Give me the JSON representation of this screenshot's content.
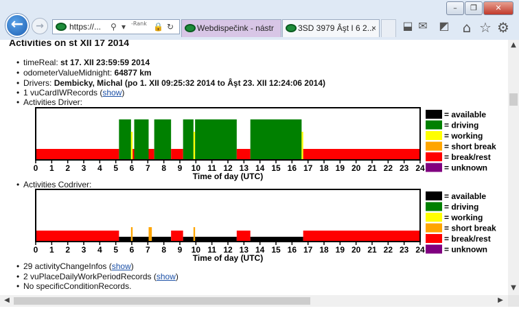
{
  "browser": {
    "window_controls": [
      "–",
      "❐",
      "✕"
    ],
    "back_glyph": "←",
    "forward_glyph": "→",
    "address_text": "https://...",
    "search_glyph": "⚲",
    "dropdown_glyph": "▾",
    "rank_text": "-Rank",
    "lock_glyph": "🔒",
    "refresh_glyph": "↻",
    "tabs": [
      {
        "label": "Webdispečink - nástr",
        "active": true
      },
      {
        "label": "3SD 3979 Âşt I 6 2...",
        "active": false
      }
    ],
    "tab_close": "×",
    "toolbar_icons": [
      "⬓",
      "✉",
      "◩",
      "⌂",
      "☆",
      "⚙"
    ]
  },
  "page": {
    "title": "Activities on st XII 17 2014",
    "items": [
      {
        "key": "timeReal:",
        "value": "st 17. XII 23:59:59 2014"
      },
      {
        "key": "odometerValueMidnight:",
        "value": "64877 km"
      },
      {
        "key": "Drivers:",
        "value": "Dembicky, Michal (po 1. XII 09:25:32 2014 to Âşt 23. XII 12:24:06 2014)"
      },
      {
        "key": "1 vuCardIWRecords (",
        "link": "show",
        "tail": ")"
      },
      {
        "key": "Activities Driver:"
      }
    ],
    "codriver_label": "Activities Codriver:",
    "bottom_items": [
      {
        "key": "29 activityChangeInfos (",
        "link": "show",
        "tail": ")"
      },
      {
        "key": "2 vuPlaceDailyWorkPeriodRecords (",
        "link": "show",
        "tail": ")"
      },
      {
        "key": "No specificConditionRecords."
      }
    ]
  },
  "chart_data": [
    {
      "type": "timeline",
      "title": "",
      "xlabel": "Time of day (UTC)",
      "xlim": [
        0,
        24
      ],
      "x_ticks": [
        0,
        1,
        2,
        3,
        4,
        5,
        6,
        7,
        8,
        9,
        10,
        11,
        12,
        13,
        14,
        15,
        16,
        17,
        18,
        19,
        20,
        21,
        22,
        23,
        24
      ],
      "legend": [
        {
          "label": "= available",
          "color": "#000000"
        },
        {
          "label": "= driving",
          "color": "#008000"
        },
        {
          "label": "= working",
          "color": "#ffff00"
        },
        {
          "label": "= short break",
          "color": "#ffa500"
        },
        {
          "label": "= break/rest",
          "color": "#ff0000"
        },
        {
          "label": "= unknown",
          "color": "#800080"
        }
      ],
      "segments": [
        {
          "start": 0.0,
          "end": 5.2,
          "activity": "break/rest"
        },
        {
          "start": 5.2,
          "end": 5.95,
          "activity": "driving"
        },
        {
          "start": 5.95,
          "end": 6.05,
          "activity": "working"
        },
        {
          "start": 6.05,
          "end": 6.15,
          "activity": "break/rest"
        },
        {
          "start": 6.15,
          "end": 7.05,
          "activity": "driving"
        },
        {
          "start": 7.05,
          "end": 7.4,
          "activity": "break/rest"
        },
        {
          "start": 7.4,
          "end": 8.45,
          "activity": "driving"
        },
        {
          "start": 8.45,
          "end": 9.2,
          "activity": "break/rest"
        },
        {
          "start": 9.2,
          "end": 9.85,
          "activity": "driving"
        },
        {
          "start": 9.85,
          "end": 9.95,
          "activity": "working"
        },
        {
          "start": 9.95,
          "end": 12.55,
          "activity": "driving"
        },
        {
          "start": 12.55,
          "end": 13.4,
          "activity": "break/rest"
        },
        {
          "start": 13.4,
          "end": 16.6,
          "activity": "driving"
        },
        {
          "start": 16.6,
          "end": 16.7,
          "activity": "working"
        },
        {
          "start": 16.7,
          "end": 24.0,
          "activity": "break/rest"
        }
      ]
    },
    {
      "type": "timeline",
      "title": "",
      "xlabel": "Time of day (UTC)",
      "xlim": [
        0,
        24
      ],
      "x_ticks": [
        0,
        1,
        2,
        3,
        4,
        5,
        6,
        7,
        8,
        9,
        10,
        11,
        12,
        13,
        14,
        15,
        16,
        17,
        18,
        19,
        20,
        21,
        22,
        23,
        24
      ],
      "legend": [
        {
          "label": "= available",
          "color": "#000000"
        },
        {
          "label": "= driving",
          "color": "#008000"
        },
        {
          "label": "= working",
          "color": "#ffff00"
        },
        {
          "label": "= short break",
          "color": "#ffa500"
        },
        {
          "label": "= break/rest",
          "color": "#ff0000"
        },
        {
          "label": "= unknown",
          "color": "#800080"
        }
      ],
      "segments": [
        {
          "start": 0.0,
          "end": 5.2,
          "activity": "break/rest"
        },
        {
          "start": 5.2,
          "end": 5.95,
          "activity": "available"
        },
        {
          "start": 5.95,
          "end": 6.05,
          "activity": "short break"
        },
        {
          "start": 6.05,
          "end": 7.05,
          "activity": "available"
        },
        {
          "start": 7.05,
          "end": 7.25,
          "activity": "short break"
        },
        {
          "start": 7.25,
          "end": 8.45,
          "activity": "available"
        },
        {
          "start": 8.45,
          "end": 9.2,
          "activity": "break/rest"
        },
        {
          "start": 9.2,
          "end": 9.85,
          "activity": "available"
        },
        {
          "start": 9.85,
          "end": 9.95,
          "activity": "short break"
        },
        {
          "start": 9.95,
          "end": 12.55,
          "activity": "available"
        },
        {
          "start": 12.55,
          "end": 13.4,
          "activity": "break/rest"
        },
        {
          "start": 13.4,
          "end": 16.7,
          "activity": "available"
        },
        {
          "start": 16.7,
          "end": 24.0,
          "activity": "break/rest"
        }
      ]
    }
  ]
}
